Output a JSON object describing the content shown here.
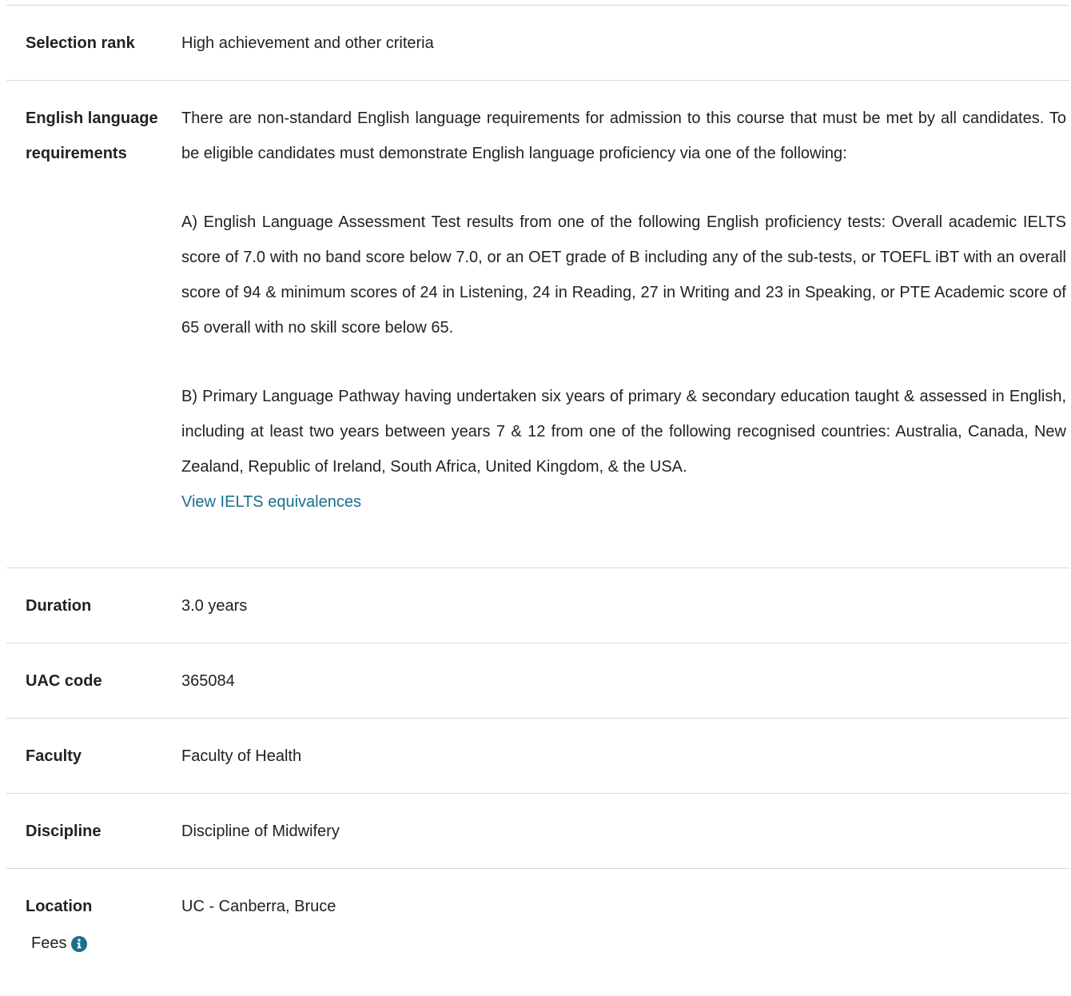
{
  "rows": [
    {
      "label": "Selection rank",
      "value": "High achievement and other criteria"
    },
    {
      "label": "English language requirements",
      "paragraphs": [
        "There are non-standard English language requirements for admission to this course that must be met by all candidates. To be eligible candidates must demonstrate English language proficiency via one of the following:",
        "A) English Language Assessment Test results from one of the following English proficiency tests: Overall academic IELTS score of 7.0 with no band score below 7.0, or an OET grade of B including any of the sub-tests, or TOEFL iBT with an overall score of 94 & minimum scores of 24 in Listening, 24 in Reading, 27 in Writing and 23 in Speaking, or PTE Academic score of 65 overall with no skill score below 65.",
        "B) Primary Language Pathway having undertaken six years of primary & secondary education taught & assessed in English, including at least two years between years 7 & 12 from one of the following recognised countries: Australia, Canada, New Zealand, Republic of Ireland, South Africa, United Kingdom, & the USA."
      ],
      "link": "View IELTS equivalences"
    },
    {
      "label": "Duration",
      "value": "3.0 years"
    },
    {
      "label": "UAC code",
      "value": "365084"
    },
    {
      "label": "Faculty",
      "value": "Faculty of Health"
    },
    {
      "label": "Discipline",
      "value": "Discipline of Midwifery"
    },
    {
      "label": "Location",
      "value": "UC - Canberra, Bruce"
    }
  ],
  "fees": {
    "label": "Fees",
    "icon": "info-icon"
  },
  "colors": {
    "link": "#1b6f8f",
    "divider": "#d9d9d9",
    "text": "#222222"
  }
}
